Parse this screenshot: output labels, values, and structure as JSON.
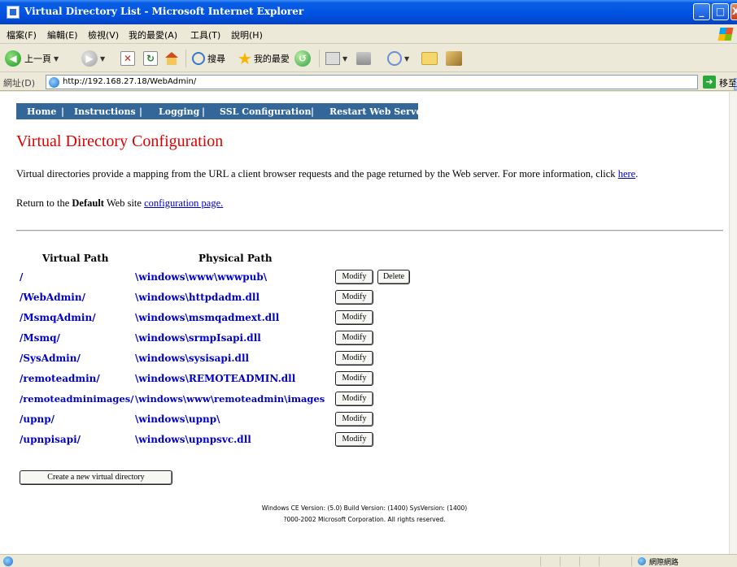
{
  "window": {
    "title": "Virtual Directory List - Microsoft Internet Explorer",
    "min": "_",
    "max": "□",
    "close": "X"
  },
  "menu": {
    "items": [
      "檔案(F)",
      "編輯(E)",
      "檢視(V)",
      "我的最愛(A)",
      "工具(T)",
      "說明(H)"
    ]
  },
  "toolbar": {
    "back_label": "上一頁",
    "search_label": "搜尋",
    "favorites_label": "我的最愛"
  },
  "address": {
    "label": "網址(D)",
    "url": "http://192.168.27.18/WebAdmin/",
    "go_label": "移至"
  },
  "nav": {
    "items": [
      "Home",
      "Instructions",
      "Logging",
      "SSL Configuration",
      "Restart Web Server"
    ],
    "separator": "|"
  },
  "page": {
    "title": "Virtual Directory Configuration",
    "intro_text": "Virtual directories provide a mapping from the URL a client browser requests and the page returned by the Web server. For more information, click ",
    "intro_link": "here",
    "intro_end": ".",
    "return_prefix": "Return to the ",
    "return_bold": "Default",
    "return_middle": " Web site ",
    "return_link": "configuration page."
  },
  "table": {
    "headers": [
      "Virtual Path",
      "Physical Path"
    ],
    "rows": [
      {
        "virtual": "/",
        "physical": "\\windows\\www\\wwwpub\\",
        "modify": "Modify",
        "delete": "Delete"
      },
      {
        "virtual": "/WebAdmin/",
        "physical": "\\windows\\httpdadm.dll",
        "modify": "Modify"
      },
      {
        "virtual": "/MsmqAdmin/",
        "physical": "\\windows\\msmqadmext.dll",
        "modify": "Modify"
      },
      {
        "virtual": "/Msmq/",
        "physical": "\\windows\\srmpIsapi.dll",
        "modify": "Modify"
      },
      {
        "virtual": "/SysAdmin/",
        "physical": "\\windows\\sysisapi.dll",
        "modify": "Modify"
      },
      {
        "virtual": "/remoteadmin/",
        "physical": "\\windows\\REMOTEADMIN.dll",
        "modify": "Modify"
      },
      {
        "virtual": "/remoteadminimages/",
        "physical": "\\windows\\www\\remoteadmin\\images",
        "modify": "Modify"
      },
      {
        "virtual": "/upnp/",
        "physical": "\\windows\\upnp\\",
        "modify": "Modify"
      },
      {
        "virtual": "/upnpisapi/",
        "physical": "\\windows\\upnpsvc.dll",
        "modify": "Modify"
      }
    ],
    "create_label": "Create a new virtual directory"
  },
  "footer": {
    "version": "Windows CE Version: (5.0) Build Version: (1400) SysVersion: (1400)",
    "copyright": "?000-2002 Microsoft Corporation. All rights reserved."
  },
  "status": {
    "zone": "網際網路"
  }
}
